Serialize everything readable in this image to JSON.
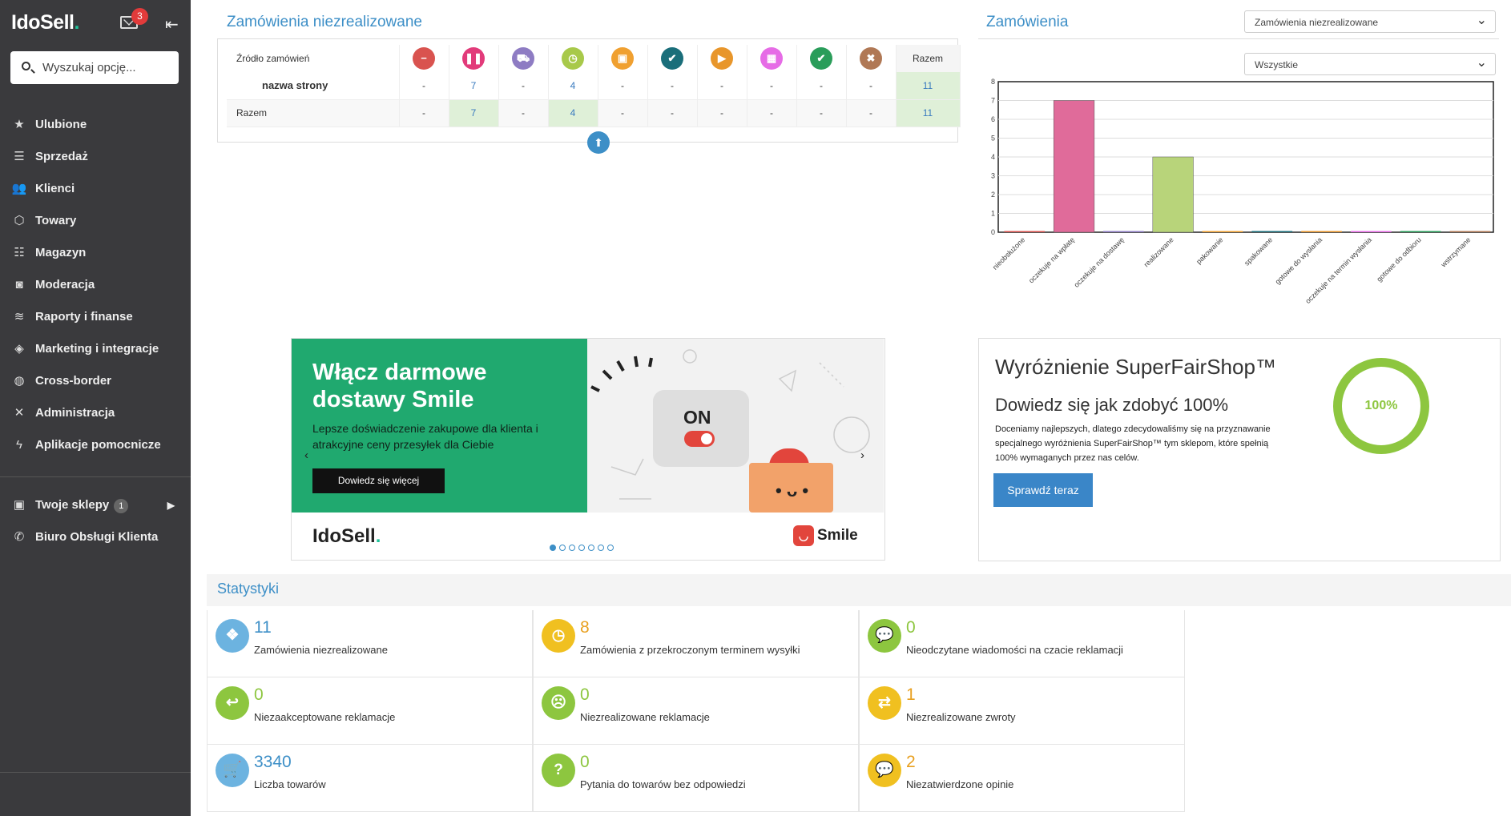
{
  "sidebar": {
    "logo": "IdoSell",
    "logo_dot": ".",
    "mail_badge": "3",
    "search_placeholder": "Wyszukaj opcję...",
    "items": [
      {
        "label": "Ulubione",
        "icon": "star-icon"
      },
      {
        "label": "Sprzedaż",
        "icon": "sales-icon"
      },
      {
        "label": "Klienci",
        "icon": "users-icon"
      },
      {
        "label": "Towary",
        "icon": "box-icon"
      },
      {
        "label": "Magazyn",
        "icon": "warehouse-icon"
      },
      {
        "label": "Moderacja",
        "icon": "camera-icon"
      },
      {
        "label": "Raporty i finanse",
        "icon": "layers-icon"
      },
      {
        "label": "Marketing i integracje",
        "icon": "tag-icon"
      },
      {
        "label": "Cross-border",
        "icon": "globe-icon"
      },
      {
        "label": "Administracja",
        "icon": "tools-icon"
      },
      {
        "label": "Aplikacje pomocnicze",
        "icon": "bolt-icon"
      }
    ],
    "shops": {
      "label": "Twoje sklepy",
      "badge": "1"
    },
    "support": {
      "label": "Biuro Obsługi Klienta"
    }
  },
  "orders": {
    "title": "Zamówienia niezrealizowane",
    "source_header": "Źródło zamówień",
    "total_header": "Razem",
    "status_icons": [
      {
        "icon": "minus-icon",
        "color": "#d9534f",
        "glyph": "−"
      },
      {
        "icon": "pause-icon",
        "color": "#e23b7a",
        "glyph": "❚❚"
      },
      {
        "icon": "truck-icon",
        "color": "#8e7cc3",
        "glyph": "⛟"
      },
      {
        "icon": "clock-icon",
        "color": "#a8c94a",
        "glyph": "◷"
      },
      {
        "icon": "box-icon",
        "color": "#f0a030",
        "glyph": "▣"
      },
      {
        "icon": "check-icon",
        "color": "#1a6e7a",
        "glyph": "✔"
      },
      {
        "icon": "play-icon",
        "color": "#e8962b",
        "glyph": "▶"
      },
      {
        "icon": "calendar-icon",
        "color": "#e66ce6",
        "glyph": "▦"
      },
      {
        "icon": "check-circle-icon",
        "color": "#2a9d5a",
        "glyph": "✔"
      },
      {
        "icon": "cancel-icon",
        "color": "#b07855",
        "glyph": "✖"
      }
    ],
    "rows": [
      {
        "label": "nazwa strony",
        "values": [
          "-",
          "7",
          "-",
          "4",
          "-",
          "-",
          "-",
          "-",
          "-",
          "-"
        ],
        "total": "11"
      },
      {
        "label": "Razem",
        "values": [
          "-",
          "7",
          "-",
          "4",
          "-",
          "-",
          "-",
          "-",
          "-",
          "-"
        ],
        "total": "11"
      }
    ]
  },
  "orders_chart": {
    "title": "Zamówienia",
    "select1": "Zamówienia niezrealizowane",
    "select2": "Wszystkie"
  },
  "chart_data": {
    "type": "bar",
    "categories": [
      "nieobsłużone",
      "oczekuje na wpłatę",
      "oczekuje na dostawę",
      "realizowane",
      "pakowanie",
      "spakowane",
      "gotowe do wysłania",
      "oczekuje na termin wysłania",
      "gotowe do odbioru",
      "wstrzymane"
    ],
    "values": [
      0,
      7,
      0,
      4,
      0,
      0,
      0,
      0,
      0,
      0
    ],
    "colors": [
      "#d9534f",
      "#e06b9a",
      "#8e7cc3",
      "#b8d47a",
      "#f0a030",
      "#1a6e7a",
      "#e8962b",
      "#e66ce6",
      "#2a9d5a",
      "#b07855"
    ],
    "ylim": [
      0,
      8
    ],
    "yticks": [
      0,
      1,
      2,
      3,
      4,
      5,
      6,
      7,
      8
    ],
    "grid": true
  },
  "banner": {
    "headline": "Włącz darmowe dostawy Smile",
    "text": "Lepsze doświadczenie zakupowe dla klienta i atrakcyjne ceny przesyłek dla Ciebie",
    "button": "Dowiedz się więcej",
    "on_label": "ON",
    "brand": "IdoSell",
    "brand_dot": ".",
    "partner": "Smile"
  },
  "superfair": {
    "title": "Wyróżnienie SuperFairShop™",
    "subtitle": "Dowiedz się jak zdobyć 100%",
    "description": "Doceniamy najlepszych, dlatego zdecydowaliśmy się na przyznawanie specjalnego wyróżnienia SuperFairShop™ tym sklepom, które spełnią 100% wymaganych przez nas celów.",
    "button": "Sprawdź teraz",
    "progress_label": "100%",
    "progress": 1.0
  },
  "stats": {
    "title": "Statystyki",
    "items": [
      {
        "value": "11",
        "label": "Zamówienia niezrealizowane",
        "icon": "dropbox-icon",
        "color": "#6cb3e0",
        "numcolor": "#3d8fc7",
        "glyph": "❖"
      },
      {
        "value": "8",
        "label": "Zamówienia z przekroczonym terminem wysyłki",
        "icon": "clock-icon",
        "color": "#f0c020",
        "numcolor": "#e8a020",
        "glyph": "◷"
      },
      {
        "value": "0",
        "label": "Nieodczytane wiadomości na czacie reklamacji",
        "icon": "chat-icon",
        "color": "#8dc63f",
        "numcolor": "#8dc63f",
        "glyph": "💬"
      },
      {
        "value": "0",
        "label": "Niezaakceptowane reklamacje",
        "icon": "reply-icon",
        "color": "#8dc63f",
        "numcolor": "#8dc63f",
        "glyph": "↩"
      },
      {
        "value": "0",
        "label": "Niezrealizowane reklamacje",
        "icon": "frown-icon",
        "color": "#8dc63f",
        "numcolor": "#8dc63f",
        "glyph": "☹"
      },
      {
        "value": "1",
        "label": "Niezrealizowane zwroty",
        "icon": "retweet-icon",
        "color": "#f0c020",
        "numcolor": "#e8a020",
        "glyph": "⇄"
      },
      {
        "value": "3340",
        "label": "Liczba towarów",
        "icon": "cart-icon",
        "color": "#6cb3e0",
        "numcolor": "#3d8fc7",
        "glyph": "🛒"
      },
      {
        "value": "0",
        "label": "Pytania do towarów bez odpowiedzi",
        "icon": "question-icon",
        "color": "#8dc63f",
        "numcolor": "#8dc63f",
        "glyph": "?"
      },
      {
        "value": "2",
        "label": "Niezatwierdzone opinie",
        "icon": "comments-icon",
        "color": "#f0c020",
        "numcolor": "#e8a020",
        "glyph": "💬"
      }
    ]
  }
}
